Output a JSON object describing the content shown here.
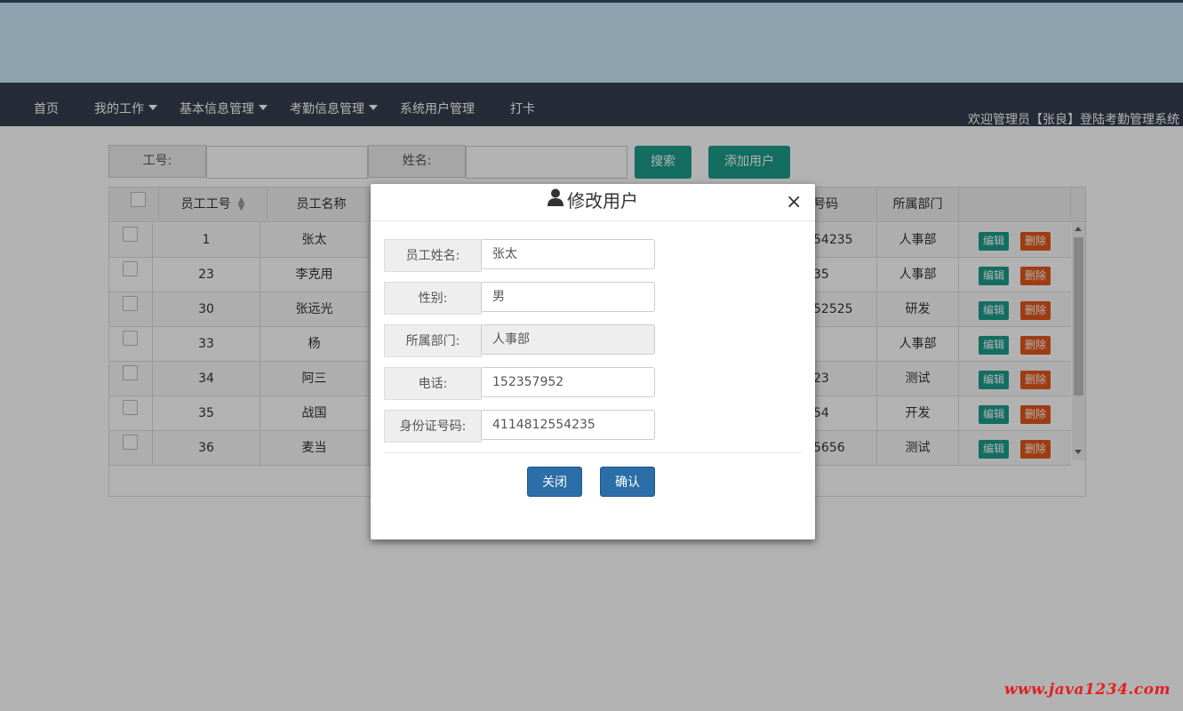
{
  "nav": {
    "items": [
      "首页",
      "我的工作",
      "基本信息管理",
      "考勤信息管理",
      "系统用户管理",
      "打卡"
    ],
    "welcome": "欢迎管理员【张良】登陆考勤管理系统"
  },
  "search": {
    "id_label": "工号:",
    "name_label": "姓名:",
    "search_button": "搜索",
    "add_button": "添加用户"
  },
  "table": {
    "columns": [
      "员工工号",
      "员工名称",
      "号码",
      "所属部门"
    ],
    "rows": [
      {
        "id": "1",
        "name": "张太",
        "id_number": "54235",
        "dept": "人事部"
      },
      {
        "id": "23",
        "name": "李克用",
        "id_number": "35",
        "dept": "人事部"
      },
      {
        "id": "30",
        "name": "张远光",
        "id_number": "52525",
        "dept": "研发"
      },
      {
        "id": "33",
        "name": "杨",
        "id_number": "",
        "dept": "人事部"
      },
      {
        "id": "34",
        "name": "阿三",
        "id_number": "23",
        "dept": "测试"
      },
      {
        "id": "35",
        "name": "战国",
        "id_number": "54",
        "dept": "开发"
      },
      {
        "id": "36",
        "name": "麦当",
        "id_number": "5656",
        "dept": "测试"
      }
    ],
    "edit_label": "编辑",
    "delete_label": "删除"
  },
  "modal": {
    "title": "修改用户",
    "close_symbol": "×",
    "fields": [
      {
        "label": "员工姓名:",
        "value": "张太"
      },
      {
        "label": "性别:",
        "value": "男"
      },
      {
        "label": "所属部门:",
        "value": "人事部"
      },
      {
        "label": "电话:",
        "value": "152357952"
      },
      {
        "label": "身份证号码:",
        "value": "4114812554235"
      }
    ],
    "close_button": "关闭",
    "confirm_button": "确认"
  },
  "watermark": "www.java1234.com",
  "colors": {
    "navbar": "#373f4f",
    "banner": "#cbe7fb",
    "teal": "#1c9d8b",
    "danger": "#e2571c",
    "primary": "#2b6ea8",
    "watermark": "#e02020"
  },
  "icons": [
    "user-icon",
    "close-icon",
    "sort-icon",
    "caret-down-icon"
  ]
}
